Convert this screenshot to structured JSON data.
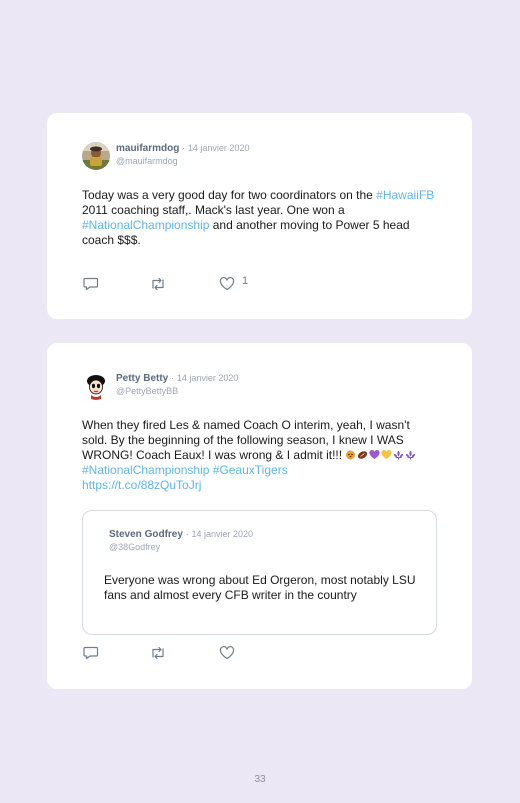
{
  "tweets": [
    {
      "name": "mauifarmdog",
      "separator": "·",
      "date": "14 janvier 2020",
      "handle": "@mauifarmdog",
      "text_parts": [
        "Today was a very good day for two coordinators on the ",
        "#HawaiiFB",
        " 2011 coaching staff,. Mack's last year. One won a ",
        "#NationalChampionship",
        " and another moving to Power 5 head coach $$$."
      ],
      "like_count": "1"
    },
    {
      "name": "Petty Betty",
      "separator": "·",
      "date": "14 janvier 2020",
      "handle": "@PettyBettyBB",
      "text_parts": [
        "When they fired Les & named Coach O interim, yeah, I wasn't sold. By the beginning of the following season, I knew I WAS WRONG! Coach Eaux! I was wrong & I admit it!!! ",
        "#NationalChampionship",
        " ",
        "#GeauxTigers",
        "https://t.co/88zQuToJrj"
      ],
      "emojis": [
        "tiger-face",
        "football",
        "purple-heart",
        "yellow-heart",
        "fleur-de-lis",
        "fleur-de-lis"
      ],
      "quoted": {
        "name": "Steven Godfrey",
        "separator": "·",
        "date": "14 janvier 2020",
        "handle": "@38Godfrey",
        "text": "Everyone was wrong about Ed Orgeron, most notably LSU fans and almost every CFB writer in the country"
      }
    }
  ],
  "page_number": "33",
  "colors": {
    "background": "#ebe7f5",
    "card": "#ffffff",
    "link": "#5fb4ea",
    "name": "#5a6b7e",
    "muted": "#9aa6b2"
  },
  "icons": [
    "reply-icon",
    "retweet-icon",
    "like-icon"
  ]
}
